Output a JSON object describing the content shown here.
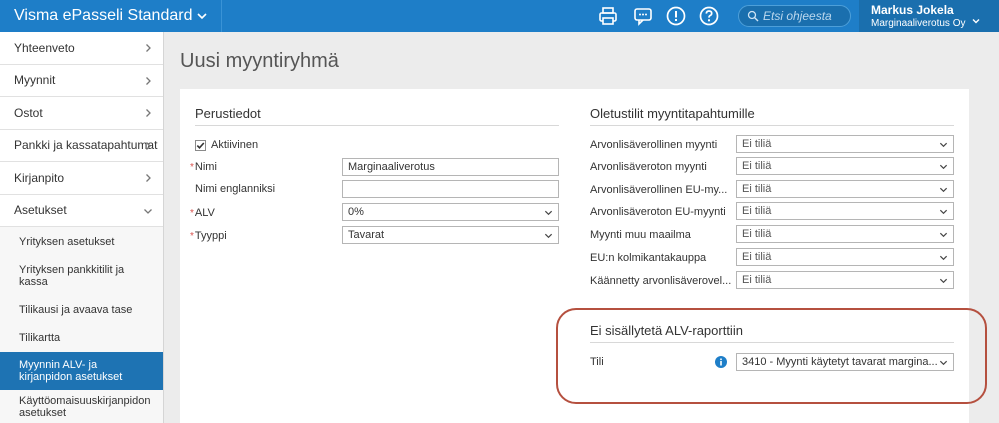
{
  "app": {
    "title": "Visma ePasseli Standard"
  },
  "topbar": {
    "search_placeholder": "Etsi ohjeesta",
    "user_name": "Markus Jokela",
    "company": "Marginaaliverotus Oy"
  },
  "sidebar": {
    "items": [
      {
        "label": "Yhteenveto"
      },
      {
        "label": "Myynnit"
      },
      {
        "label": "Ostot"
      },
      {
        "label": "Pankki ja kassatapahtumat"
      },
      {
        "label": "Kirjanpito"
      },
      {
        "label": "Asetukset"
      }
    ],
    "subitems": [
      {
        "label": "Yrityksen asetukset"
      },
      {
        "label": "Yrityksen pankkitilit ja kassa"
      },
      {
        "label": "Tilikausi ja avaava tase"
      },
      {
        "label": "Tilikartta"
      },
      {
        "label": "Myynnin ALV- ja kirjanpidon asetukset"
      },
      {
        "label": "Käyttöomaisuuskirjanpidon asetukset"
      }
    ]
  },
  "page": {
    "title": "Uusi myyntiryhmä"
  },
  "basics": {
    "title": "Perustiedot",
    "active_label": "Aktiivinen",
    "name_label": "Nimi",
    "name_value": "Marginaaliverotus",
    "name_en_label": "Nimi englanniksi",
    "name_en_value": "",
    "vat_label": "ALV",
    "vat_value": "0%",
    "type_label": "Tyyppi",
    "type_value": "Tavarat"
  },
  "defaults": {
    "title": "Oletustilit myyntitapahtumille",
    "rows": [
      {
        "label": "Arvonlisäverollinen myynti",
        "value": "Ei tiliä"
      },
      {
        "label": "Arvonlisäveroton myynti",
        "value": "Ei tiliä"
      },
      {
        "label": "Arvonlisäverollinen EU-my...",
        "value": "Ei tiliä"
      },
      {
        "label": "Arvonlisäveroton EU-myynti",
        "value": "Ei tiliä"
      },
      {
        "label": "Myynti muu maailma",
        "value": "Ei tiliä"
      },
      {
        "label": "EU:n kolmikantakauppa",
        "value": "Ei tiliä"
      },
      {
        "label": "Käännetty arvonlisäverovel...",
        "value": "Ei tiliä"
      }
    ]
  },
  "excluded": {
    "title": "Ei sisällytetä ALV-raporttiin",
    "account_label": "Tili",
    "account_value": "3410 - Myynti käytetyt tavarat margina..."
  },
  "colors": {
    "topbar": "#1e7ec8",
    "active_nav": "#1e73b3",
    "required": "#d9534f",
    "highlight": "#b5503f"
  }
}
